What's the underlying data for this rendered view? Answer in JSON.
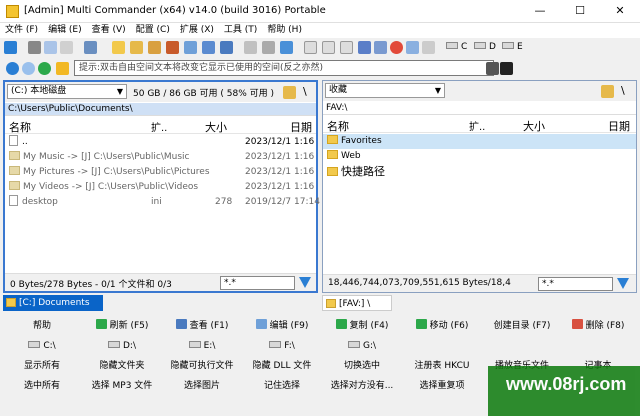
{
  "window": {
    "title": "[Admin] Multi Commander (x64)  v14.0 (build 3016) Portable"
  },
  "menu": [
    "文件 (F)",
    "编辑 (E)",
    "查看 (V)",
    "配置 (C)",
    "扩展 (X)",
    "工具 (T)",
    "帮助 (H)"
  ],
  "toolbar": {
    "drives": [
      "C",
      "D",
      "E"
    ]
  },
  "address": {
    "placeholder": "提示:双击自由空间文本将改变它显示已使用的空间(反之亦然)"
  },
  "left_panel": {
    "drive_label": "(C:) 本地磁盘",
    "free_space": "50 GB / 86 GB 可用 ( 58% 可用 )",
    "path": "C:\\Users\\Public\\Documents\\",
    "columns": [
      "名称",
      "扩..",
      "大小",
      "日期"
    ],
    "rows": [
      {
        "name": "..",
        "ext": "",
        "size": "",
        "date": "2023/12/1 1:16"
      },
      {
        "name": "My Music ->  [J] C:\\Users\\Public\\Music",
        "ext": "",
        "size": "",
        "date": "2023/12/1 1:16"
      },
      {
        "name": "My Pictures ->  [J] C:\\Users\\Public\\Pictures",
        "ext": "",
        "size": "",
        "date": "2023/12/1 1:16"
      },
      {
        "name": "My Videos ->  [J] C:\\Users\\Public\\Videos",
        "ext": "",
        "size": "",
        "date": "2023/12/1 1:16"
      },
      {
        "name": "desktop",
        "ext": "ini",
        "size": "278",
        "date": "2019/12/7 17:14"
      }
    ],
    "status": "0 Bytes/278 Bytes - 0/1 个文件和 0/3",
    "filter": "*.*",
    "tab": "[C:] Documents"
  },
  "right_panel": {
    "drive_label": "收藏",
    "path": "FAV:\\",
    "columns": [
      "名称",
      "扩..",
      "大小",
      "日期"
    ],
    "rows": [
      {
        "name": "Favorites"
      },
      {
        "name": "Web"
      },
      {
        "name": "快捷路径"
      }
    ],
    "status": "18,446,744,073,709,551,615 Bytes/18,4",
    "filter": "*.*",
    "tab": "[FAV:] \\"
  },
  "user_buttons": [
    [
      "帮助",
      "刷新 (F5)",
      "查看 (F1)",
      "编辑 (F9)",
      "复制 (F4)",
      "移动 (F6)",
      "创建目录 (F7)",
      "删除 (F8)"
    ],
    [
      "C:\\",
      "D:\\",
      "E:\\",
      "F:\\",
      "G:\\",
      "",
      "",
      ""
    ],
    [
      "显示所有",
      "隐藏文件夹",
      "隐藏可执行文件",
      "隐藏 DLL 文件",
      "切换选中",
      "注册表 HKCU",
      "播放音乐文件",
      "记事本"
    ],
    [
      "选中所有",
      "选择 MP3 文件",
      "选择图片",
      "记住选择",
      "选择对方没有...",
      "选择重复项",
      "",
      ""
    ]
  ],
  "watermark": "www.08rj.com"
}
